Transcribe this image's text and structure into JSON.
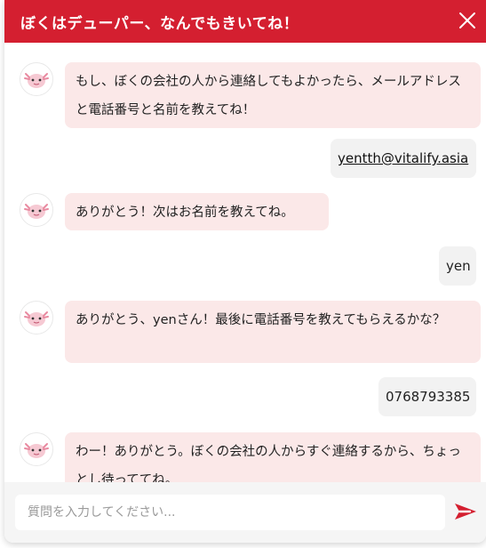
{
  "header": {
    "title": "ぼくはデューパー、なんでもきいてね！"
  },
  "messages": [
    {
      "from": "bot",
      "text": "もし、ぼくの会社の人から連絡してもよかったら、メールアドレスと電話番号と名前を教えてね！"
    },
    {
      "from": "user",
      "text": "yentth@vitalify.asia"
    },
    {
      "from": "bot",
      "text": "ありがとう！次はお名前を教えてね。"
    },
    {
      "from": "user",
      "text": "yen"
    },
    {
      "from": "bot",
      "text": "ありがとう、yenさん！最後に電話番号を教えてもらえるかな？"
    },
    {
      "from": "user",
      "text": "0768793385"
    },
    {
      "from": "bot",
      "text": "わー！ありがとう。ぼくの会社の人からすぐ連絡するから、ちょっとし待っててね。"
    }
  ],
  "input": {
    "placeholder": "質問を入力してください..."
  },
  "colors": {
    "accent": "#d41f30",
    "bot_bubble": "#fbe8e8",
    "user_bubble": "#f2f2f2"
  },
  "icons": {
    "close": "close-icon",
    "send": "send-icon",
    "avatar": "axolotl-avatar-icon"
  }
}
